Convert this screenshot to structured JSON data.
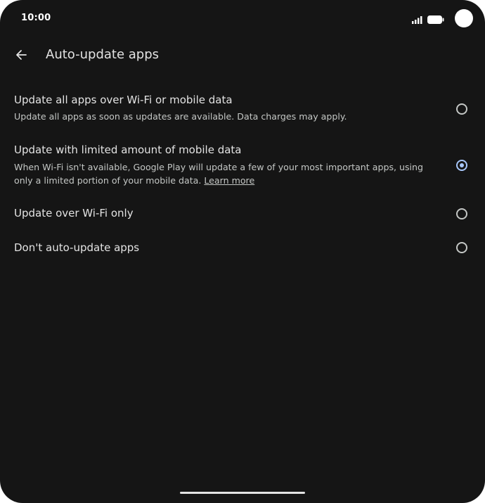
{
  "status_bar": {
    "time": "10:00",
    "icons": [
      "signal-icon",
      "battery-icon"
    ]
  },
  "app_bar": {
    "back_icon": "back-arrow-icon",
    "title": "Auto-update apps"
  },
  "options": [
    {
      "title": "Update all apps over Wi-Fi or mobile data",
      "description": "Update all apps as soon as updates are available. Data charges may apply.",
      "selected": false
    },
    {
      "title": "Update with limited amount of mobile data",
      "description": "When Wi-Fi isn't available, Google Play will update a few of your most important apps, using only a limited portion of your mobile data.",
      "link": "Learn more",
      "selected": true
    },
    {
      "title": "Update over Wi-Fi only",
      "selected": false
    },
    {
      "title": "Don't auto-update apps",
      "selected": false
    }
  ],
  "colors": {
    "background": "#151515",
    "text_primary": "#e3e3e3",
    "text_secondary": "#c4c7c5",
    "accent": "#a8c7fa"
  }
}
